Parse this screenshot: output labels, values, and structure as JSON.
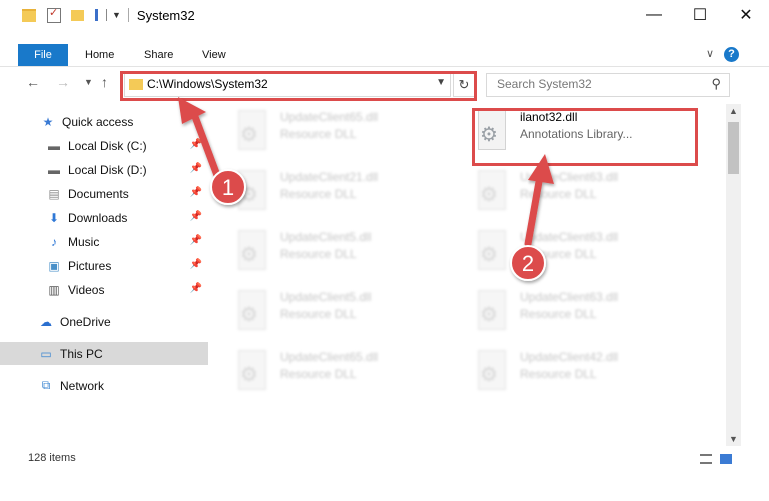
{
  "window": {
    "title": "System32",
    "controls": {
      "minimize": "—",
      "maximize": "☐",
      "close": "✕"
    }
  },
  "ribbon": {
    "tabs": [
      "File",
      "Home",
      "Share",
      "View"
    ],
    "help": "?"
  },
  "address": {
    "path": "C:\\Windows\\System32",
    "search_placeholder": "Search System32"
  },
  "sidebar": {
    "items": [
      {
        "label": "Quick access",
        "icon": "star-icon"
      },
      {
        "label": "Local Disk (C:)",
        "icon": "drive-icon",
        "pinned": true
      },
      {
        "label": "Local Disk (D:)",
        "icon": "drive-icon",
        "pinned": true
      },
      {
        "label": "Documents",
        "icon": "documents-icon",
        "pinned": true
      },
      {
        "label": "Downloads",
        "icon": "download-icon",
        "pinned": true
      },
      {
        "label": "Music",
        "icon": "music-icon",
        "pinned": true
      },
      {
        "label": "Pictures",
        "icon": "pictures-icon",
        "pinned": true
      },
      {
        "label": "Videos",
        "icon": "videos-icon",
        "pinned": true
      },
      {
        "label": "OneDrive",
        "icon": "cloud-icon"
      },
      {
        "label": "This PC",
        "icon": "computer-icon",
        "selected": true
      },
      {
        "label": "Network",
        "icon": "network-icon"
      }
    ]
  },
  "files": [
    {
      "name": "UpdateClient65.dll",
      "type": "Resource DLL"
    },
    {
      "name": "ilanot32.dll",
      "type": "Annotations Library..."
    },
    {
      "name": "UpdateClient21.dll",
      "type": "Resource DLL"
    },
    {
      "name": "UpdateClient63.dll",
      "type": "Resource DLL"
    },
    {
      "name": "UpdateClient5.dll",
      "type": "Resource DLL"
    },
    {
      "name": "UpdateClient63.dll",
      "type": "Resource DLL"
    },
    {
      "name": "UpdateClient5.dll",
      "type": "Resource DLL"
    },
    {
      "name": "UpdateClient63.dll",
      "type": "Resource DLL"
    },
    {
      "name": "UpdateClient65.dll",
      "type": "Resource DLL"
    },
    {
      "name": "UpdateClient42.dll",
      "type": "Resource DLL"
    }
  ],
  "status": {
    "count": "128 items"
  },
  "annotations": {
    "step1": "1",
    "step2": "2"
  },
  "colors": {
    "accent": "#1979ca",
    "annotation_red": "#dc4b4b"
  }
}
